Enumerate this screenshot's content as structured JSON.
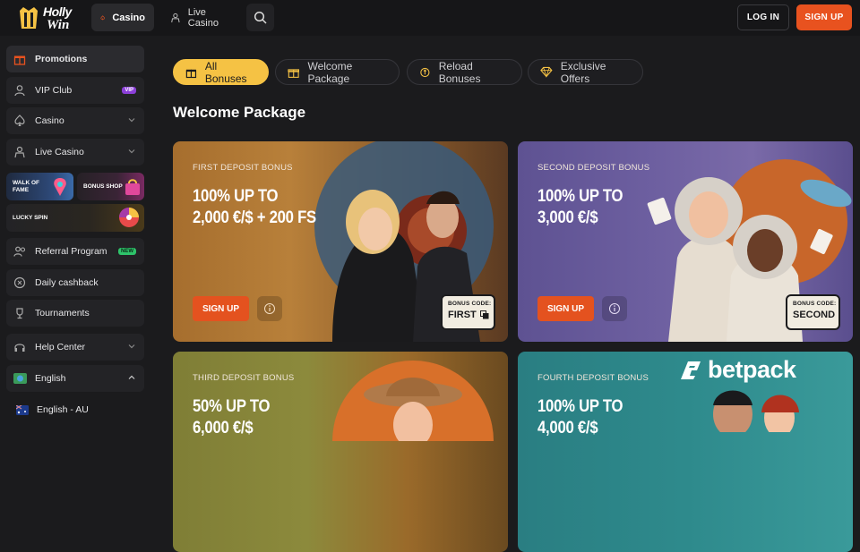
{
  "header": {
    "logo_line1": "Holly",
    "logo_line2": "Win",
    "nav": [
      {
        "label": "Casino",
        "icon": "spade-icon"
      },
      {
        "label": "Live Casino",
        "icon": "dealer-icon"
      }
    ],
    "search_icon": "search-icon",
    "login_label": "LOG IN",
    "signup_label": "SIGN UP"
  },
  "sidebar": {
    "items": [
      {
        "label": "Promotions",
        "icon": "gift-icon",
        "active": true
      },
      {
        "label": "VIP Club",
        "icon": "user-icon",
        "badge": "VIP"
      },
      {
        "label": "Casino",
        "icon": "spade-icon"
      },
      {
        "label": "Live Casino",
        "icon": "dealer-icon"
      }
    ],
    "tiles": [
      {
        "label_line1": "WALK OF",
        "label_line2": "FAME"
      },
      {
        "label_line1": "BONUS SHOP",
        "label_line2": ""
      },
      {
        "label_line1": "LUCKY SPIN",
        "label_line2": ""
      }
    ],
    "items2": [
      {
        "label": "Referral Program",
        "icon": "users-icon",
        "badge": "NEW"
      },
      {
        "label": "Daily cashback",
        "icon": "cashback-icon"
      },
      {
        "label": "Tournaments",
        "icon": "trophy-icon"
      },
      {
        "label": "Help Center",
        "icon": "headset-icon"
      },
      {
        "label": "English",
        "icon": "globe-flag-icon"
      }
    ],
    "language_option": "English - AU"
  },
  "filters": [
    {
      "label": "All Bonuses",
      "icon": "gift-icon",
      "active": true
    },
    {
      "label": "Welcome Package",
      "icon": "welcome-gift-icon"
    },
    {
      "label": "Reload Bonuses",
      "icon": "reload-icon"
    },
    {
      "label": "Exclusive Offers",
      "icon": "diamond-icon"
    }
  ],
  "section_title": "Welcome Package",
  "cards": [
    {
      "label": "FIRST DEPOSIT BONUS",
      "offer_line1": "100% UP TO",
      "offer_line2": "2,000 €/$ + 200 FS",
      "cta": "SIGN UP",
      "code_label": "BONUS CODE:",
      "code": "FIRST",
      "bg": "#b8803a"
    },
    {
      "label": "SECOND DEPOSIT BONUS",
      "offer_line1": "100% UP TO",
      "offer_line2": "3,000 €/$",
      "cta": "SIGN UP",
      "code_label": "BONUS CODE:",
      "code": "SECOND",
      "bg": "#6d5fa0"
    },
    {
      "label": "THIRD DEPOSIT BONUS",
      "offer_line1": "50% UP TO",
      "offer_line2": "6,000 €/$",
      "bg": "#8c8a3c"
    },
    {
      "label": "FOURTH DEPOSIT BONUS",
      "offer_line1": "100% UP TO",
      "offer_line2": "4,000 €/$",
      "bg": "#2e8a8c"
    }
  ],
  "watermark": "betpack",
  "colors": {
    "accent": "#e8521f",
    "filter_active": "#f5c244",
    "vip_badge": "#8b3fd8",
    "new_badge": "#2ec36a"
  }
}
